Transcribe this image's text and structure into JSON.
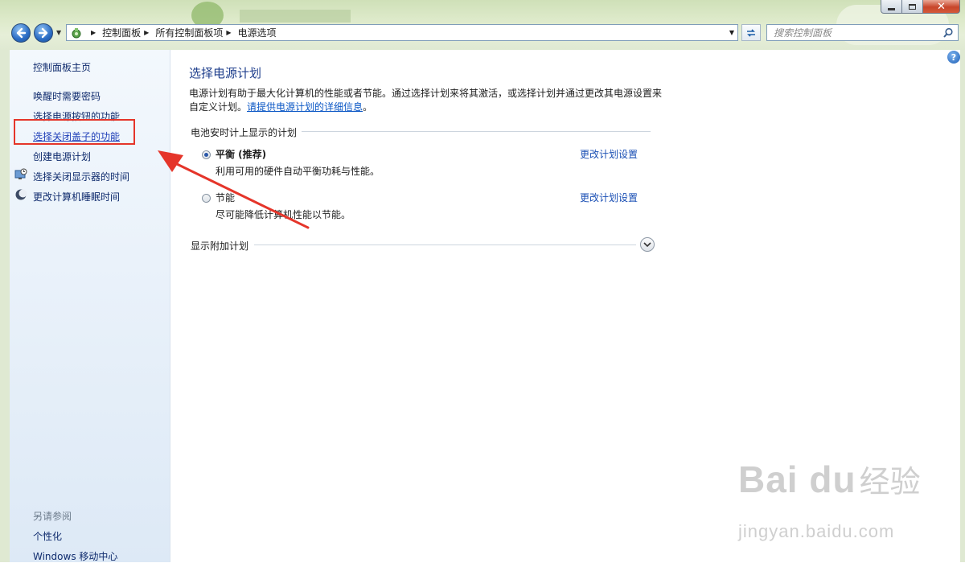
{
  "window": {
    "minimize": "−",
    "maximize": "□",
    "close": "✕"
  },
  "address_bar": {
    "breadcrumbs": [
      "控制面板",
      "所有控制面板项",
      "电源选项"
    ]
  },
  "search": {
    "placeholder": "搜索控制面板"
  },
  "sidebar": {
    "home": "控制面板主页",
    "items": [
      {
        "label": "唤醒时需要密码",
        "icon": null
      },
      {
        "label": "选择电源按钮的功能",
        "icon": null
      },
      {
        "label": "选择关闭盖子的功能",
        "icon": null
      },
      {
        "label": "创建电源计划",
        "icon": null
      },
      {
        "label": "选择关闭显示器的时间",
        "icon": "monitor-clock-icon"
      },
      {
        "label": "更改计算机睡眠时间",
        "icon": "moon-icon"
      }
    ],
    "see_also_title": "另请参阅",
    "see_also": [
      "个性化",
      "Windows 移动中心"
    ]
  },
  "main": {
    "title": "选择电源计划",
    "intro": "电源计划有助于最大化计算机的性能或者节能。通过选择计划来将其激活，或选择计划并通过更改其电源设置来自定义计划。",
    "intro_link": "请提供电源计划的详细信息",
    "intro_end": "。",
    "section_title": "电池安时计上显示的计划",
    "plans": [
      {
        "name": "平衡 (推荐)",
        "description": "利用可用的硬件自动平衡功耗与性能。",
        "selected": true,
        "link": "更改计划设置"
      },
      {
        "name": "节能",
        "description": "尽可能降低计算机性能以节能。",
        "selected": false,
        "link": "更改计划设置"
      }
    ],
    "more_plans": "显示附加计划"
  },
  "annotation": {
    "color": "#e5352a"
  },
  "watermark": {
    "logo_text": "Bai du",
    "cn_text": "经验",
    "url": "jingyan.baidu.com"
  }
}
